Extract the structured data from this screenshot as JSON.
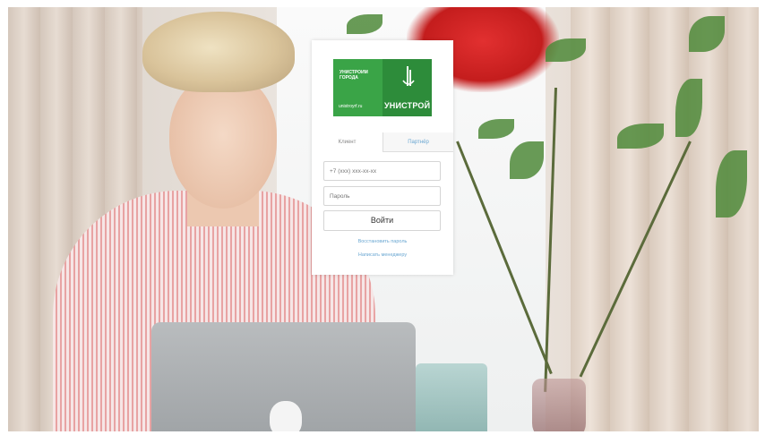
{
  "login": {
    "logo": {
      "line1": "УНИСТРОИМ",
      "line2": "ГОРОДА",
      "url": "unistroyrf.ru",
      "brand": "УНИСТРОЙ",
      "colors": {
        "green_light": "#3aa447",
        "green_dark": "#2d8c3a"
      }
    },
    "tabs": [
      {
        "label": "Клиент",
        "active": true
      },
      {
        "label": "Партнёр",
        "active": false
      }
    ],
    "phone_placeholder": "+7 (xxx) xxx-xx-xx",
    "password_placeholder": "Пароль",
    "submit_label": "Войти",
    "restore_link": "Восстановить пароль",
    "manager_link": "Написать менеджеру",
    "link_color": "#6aa7d2"
  }
}
